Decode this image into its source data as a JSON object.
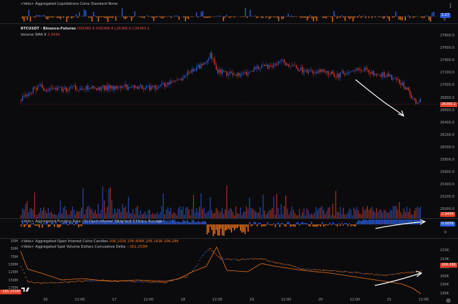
{
  "colors": {
    "up": "#2f5fe0",
    "down": "#e0402a",
    "orange": "#f0731c",
    "white": "#ffffff",
    "grid": "#1b1c21"
  },
  "pane_liq": {
    "title": "<Velo> Aggregated Liquidations Coins Standard None",
    "badge": "1.27",
    "badge_low": "0"
  },
  "pane_main": {
    "symbol": "BTCUSDT · Binance-Futures",
    "ohlc": [
      "O26365.8",
      "H26396.4",
      "L26366.9",
      "C26383.2"
    ],
    "volume_label": "Volume SMA 9",
    "volume_value": "2.943K",
    "price_badge": "26365.1",
    "volume_badge": "2.943K",
    "ticks": [
      "27800.0",
      "27600.0",
      "27400.0",
      "27200.0",
      "27000.0",
      "26800.0",
      "26600.0",
      "26400.0",
      "26200.0",
      "26000.0",
      "25800.0",
      "25600.0",
      "25400.0",
      "25200.0",
      "25000.0"
    ]
  },
  "pane_funding": {
    "title": "<Velo> Aggregated Funding Rate (%) Open Interest Weighted 8 Hours Average",
    "value": "0.0056",
    "badge": "0.0056",
    "ticks": [
      "0"
    ]
  },
  "pane_oi": {
    "title": "<Velo> Aggregated Open Interest Coins Candles",
    "values": [
      "206.102K",
      "206.406K",
      "206.163K",
      "206.28K"
    ],
    "cvd_title": "<Velo> Aggregated Spot Volume Dollars Cumulative Delta",
    "cvd_value": "−161.253M",
    "left_ticks": [
      "25M",
      "50M",
      "75M",
      "100M",
      "125M",
      "150M",
      "175M"
    ],
    "left_badge": "-161.253M",
    "right_ticks": [
      "215K",
      "210K",
      "205K",
      "200K",
      "195K",
      "190K"
    ],
    "right_badge": "206.28K"
  },
  "xaxis": [
    "16",
    "12:00",
    "17",
    "12:00",
    "18",
    "12:00",
    "19",
    "12:00",
    "20",
    "12:00",
    "21",
    "12:00"
  ]
}
